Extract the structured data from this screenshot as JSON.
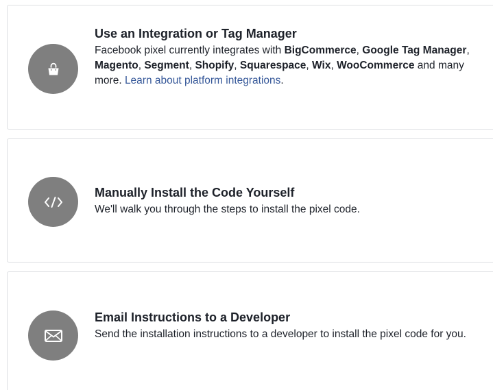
{
  "integration": {
    "title": "Use an Integration or Tag Manager",
    "intro": "Facebook pixel currently integrates with ",
    "platforms": [
      "BigCommerce",
      "Google Tag Manager",
      "Magento",
      "Segment",
      "Shopify",
      "Squarespace",
      "Wix",
      "WooCommerce"
    ],
    "separator": ", ",
    "outro": " and many more. ",
    "link_text": "Learn about platform integrations",
    "end": ".",
    "icon": "shopping-bag-icon"
  },
  "manual": {
    "title": "Manually Install the Code Yourself",
    "description": "We'll walk you through the steps to install the pixel code.",
    "icon": "code-icon"
  },
  "email": {
    "title": "Email Instructions to a Developer",
    "description": "Send the installation instructions to a developer to install the pixel code for you.",
    "icon": "envelope-icon"
  },
  "colors": {
    "icon_background": "#7f7f7f",
    "link": "#365899",
    "border": "#dddfe2",
    "text": "#1d2129"
  }
}
